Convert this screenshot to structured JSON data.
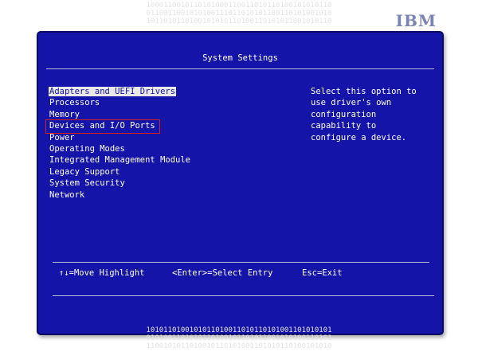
{
  "background": {
    "binary_top": [
      "1000110010110101000110011010110100101010110",
      "0110011001010100111011010101100110101001010",
      "1011010110100101010110100110101011001010110"
    ],
    "binary_bottom": [
      "1010110100101011010011010110101001101010101",
      "0101001101010110100101101011001010100110101",
      "1100101011010010110101001101010110100101010"
    ]
  },
  "brand": {
    "logo": "IBM"
  },
  "window": {
    "title": "System Settings",
    "menu_items": [
      "Adapters and UEFI Drivers",
      "Processors",
      "Memory",
      "Devices and I/O Ports",
      "Power",
      "Operating Modes",
      "Integrated Management Module",
      "Legacy Support",
      "System Security",
      "Network"
    ],
    "help_text": [
      "Select this option to",
      "use driver's own",
      "configuration",
      "capability to",
      "configure a device."
    ],
    "help_line": {
      "move": "↑↓=Move Highlight",
      "select": "<Enter>=Select Entry",
      "exit": "Esc=Exit"
    }
  },
  "colors": {
    "panel": "#1414a8",
    "text": "#ffffff",
    "selection_bg": "#e8e8e8",
    "annotation_box": "#d22020"
  }
}
